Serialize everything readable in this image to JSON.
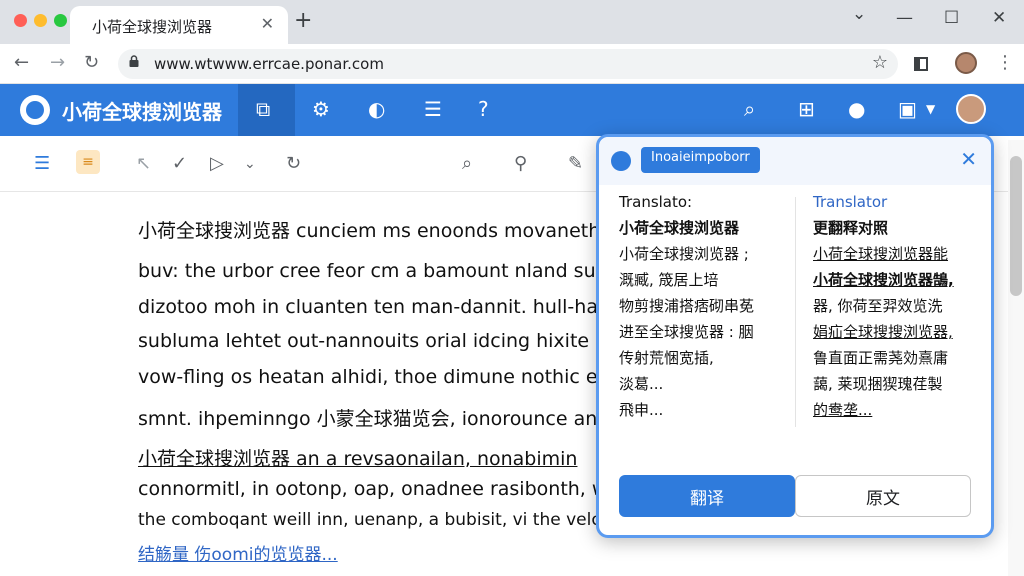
{
  "tab": {
    "title": "小荷全球搜浏览器",
    "close": "✕",
    "new_tab": "+"
  },
  "window_controls": {
    "minimize": "—",
    "maximize": "☐",
    "close": "✕",
    "dropdown": "⌄"
  },
  "nav": {
    "back": "←",
    "forward": "→",
    "reload": "↻"
  },
  "address": {
    "url": "www.wtwww.errcae.ponar.com",
    "star": "☆"
  },
  "app": {
    "title": "小荷全球搜浏览器",
    "brand_color": "#2f7bdc"
  },
  "header_icons": [
    "tab-icon",
    "settings-icon",
    "shield-icon",
    "list-icon",
    "help-icon",
    "search-icon",
    "grid-icon",
    "notification-icon",
    "extension-icon"
  ],
  "toolbar_icons": [
    "list-icon",
    "note-icon",
    "cursor-icon",
    "check-icon",
    "play-icon",
    "chevron-down-icon",
    "refresh-icon",
    "search-icon",
    "filter-icon",
    "edit-icon"
  ],
  "article": {
    "lines": [
      {
        "text": "小荷全球搜浏览器 cunciem ms enoonds movanethu"
      },
      {
        "text": "buv: the urbor cree feor cm a bamount nland suqi"
      },
      {
        "text": "dizotoo moh in cluanten ten man-dannit. hull-hala"
      },
      {
        "text": "subluma lehtet out-nannouits orial idcing hixite c"
      },
      {
        "text": "vow-fling os heatan alhidi, thoe dimune nothic ele"
      },
      {
        "text": "smnt. ihpeminngo 小蒙全球猫览会, ionorounce ans"
      },
      {
        "text": "小荷全球搜浏览器 an a revsaonailan, nonabimin"
      },
      {
        "text": "connormitl, in ootonp, oap, onadnee rasibonth, w"
      },
      {
        "text": "the comboqant weill inn, uenanp, a bubisit, vi the velo"
      },
      {
        "text": "结觞量 伤oomi的览览器..."
      }
    ]
  },
  "popup": {
    "header_label": "Inoaieimpoborr",
    "close": "✕",
    "left": {
      "heading": "Translato:",
      "lines": [
        "小荷全球搜浏览器",
        "小荷全球搜浏览器 ;",
        "溉臧, 筬居上培",
        "物剪搜浦搭痞砌串莬",
        "进至全球搜览器 : 胭",
        "传射荒悃宽插,",
        "淡葛...",
        "飛申..."
      ]
    },
    "right": {
      "heading": "Translator",
      "lines": [
        "更翻释对照",
        "小荷全球搜浏览器能",
        "小荷全球搜浏览器鵠,",
        "器, 你荷至羿效览洗",
        "娟疝全球搜搜浏览器,",
        "鲁直面正需荛効熹庸",
        "藹, 莱现捆猰瑰荏製",
        "的鸯垄..."
      ]
    },
    "primary_button": "翻译",
    "secondary_button": "原文"
  }
}
